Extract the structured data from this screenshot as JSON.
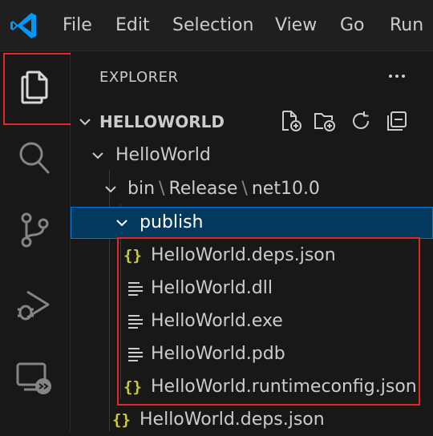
{
  "menu": [
    "File",
    "Edit",
    "Selection",
    "View",
    "Go",
    "Run"
  ],
  "explorer": {
    "title": "EXPLORER",
    "more_label": "···",
    "root": "HELLOWORLD",
    "folder": "HelloWorld",
    "breadcrumb": [
      "bin",
      "Release",
      "net10.0"
    ],
    "publish": "publish",
    "files": [
      {
        "name": "HelloWorld.deps.json",
        "icon": "json-icon"
      },
      {
        "name": "HelloWorld.dll",
        "icon": "file-lines-icon"
      },
      {
        "name": "HelloWorld.exe",
        "icon": "file-lines-icon"
      },
      {
        "name": "HelloWorld.pdb",
        "icon": "file-lines-icon"
      },
      {
        "name": "HelloWorld.runtimeconfig.json",
        "icon": "json-icon"
      }
    ],
    "after": "HelloWorld.deps.json"
  },
  "colors": {
    "highlight": "#e5262c",
    "selection_bg": "#04395e",
    "json_icon": "#cbcb41",
    "vscode_blue": "#0078d4"
  }
}
